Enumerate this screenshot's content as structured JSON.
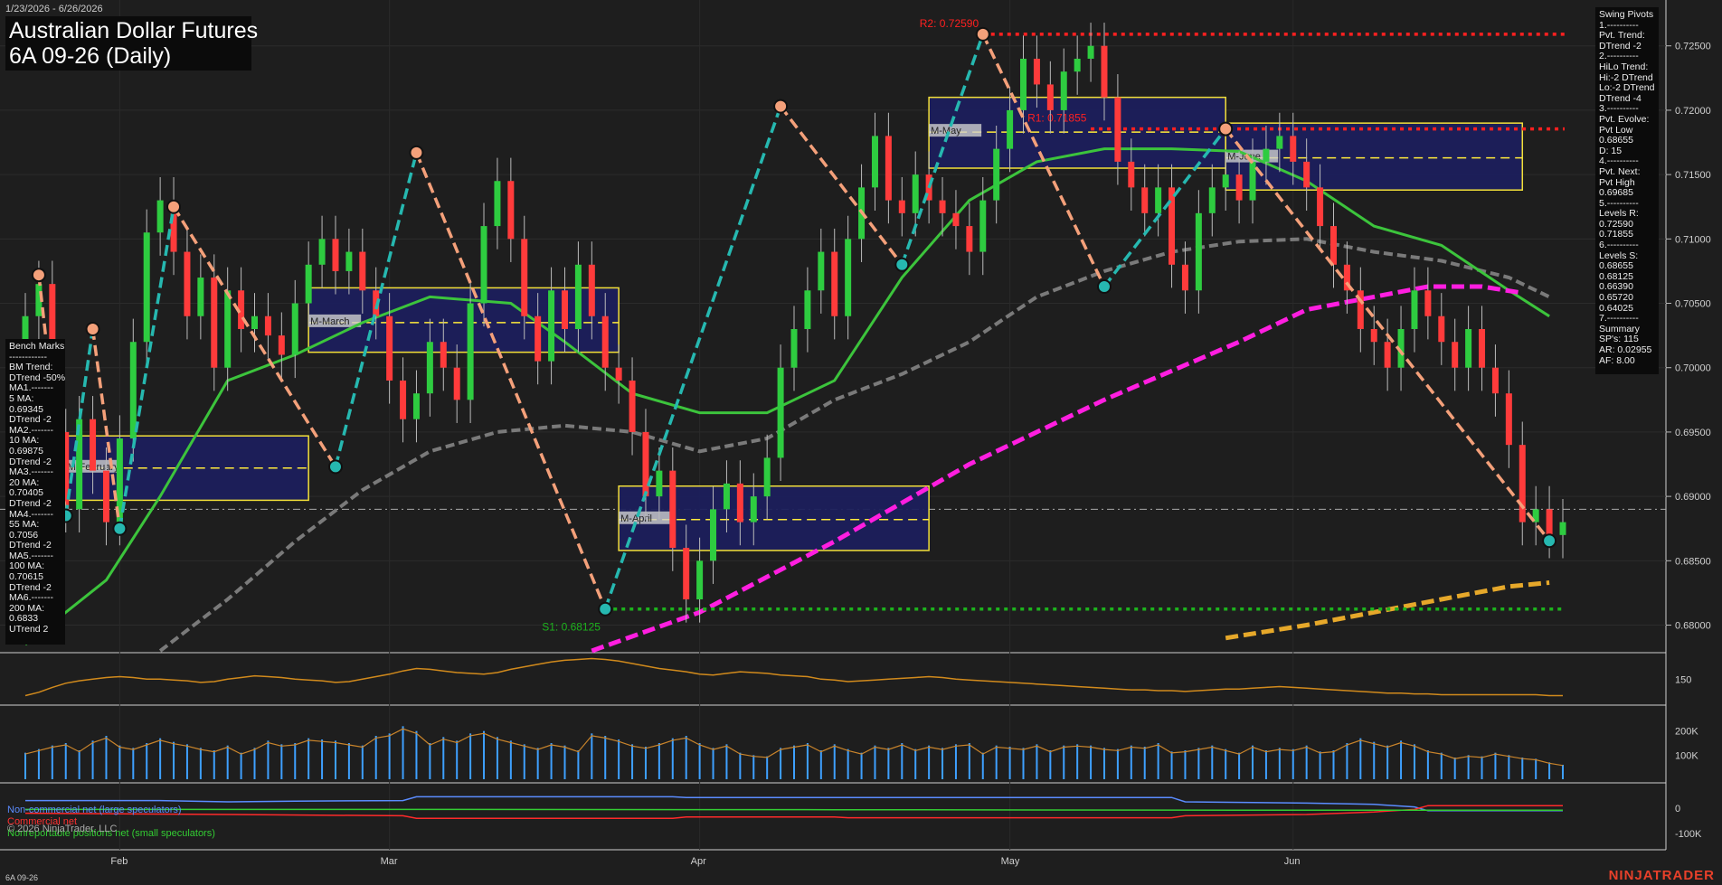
{
  "header": {
    "date_range": "1/23/2026 - 6/26/2026",
    "title_line1": "Australian Dollar Futures",
    "title_line2": "6A 09-26 (Daily)"
  },
  "footer": {
    "symbol": "6A 09-26",
    "brand": "NINJATRADER",
    "copyright": "© 2026 NinjaTrader, LLC"
  },
  "bench_marks": [
    "Bench Marks",
    "------------",
    "BM Trend:",
    "DTrend -50%",
    "MA1.-------",
    "5 MA:",
    "0.69345",
    "DTrend -2",
    "MA2.-------",
    "10 MA:",
    "0.69875",
    "DTrend -2",
    "MA3.-------",
    "20 MA:",
    "0.70405",
    "DTrend -2",
    "MA4.-------",
    "55 MA:",
    "0.7056",
    "DTrend -2",
    "MA5.-------",
    "100 MA:",
    "0.70615",
    "DTrend -2",
    "MA6.-------",
    "200 MA:",
    "0.6833",
    "UTrend 2"
  ],
  "swing_pivots": [
    "Swing Pivots",
    "1.----------",
    "Pvt. Trend:",
    "DTrend -2",
    "2.----------",
    "HiLo Trend:",
    "Hi:-2 DTrend",
    "Lo:-2 DTrend",
    "DTrend -4",
    "3.----------",
    "Pvt. Evolve:",
    "Pvt Low",
    "0.68655",
    "D: 15",
    "4.----------",
    "Pvt. Next:",
    "Pvt High",
    "0.69685",
    "5.----------",
    "Levels R:",
    "0.72590",
    "0.71855",
    "6.----------",
    "Levels S:",
    "0.68655",
    "0.68125",
    "0.66390",
    "0.65720",
    "0.64025",
    "7.----------",
    "Summary",
    "SP's: 115",
    "AR: 0.02955",
    "AF: 8.00"
  ],
  "cot_legend": {
    "noncommercial": "Non-commercial net (large speculators)",
    "commercial": "Commercial net",
    "nonreportable": "Nonreportable positions net (small speculators)"
  },
  "colors": {
    "background": "#1e1e1e",
    "up_candle": "#2ecc40",
    "down_candle": "#ff3b3b",
    "swing_up": "#26b8b0",
    "swing_down": "#f4a07a",
    "ma_green": "#3cc43c",
    "ma_grey": "#7a7a7a",
    "ma_magenta": "#ff1ee0",
    "ma_orange": "#e6a82a",
    "resistance": "#ff2020",
    "support": "#1db31d",
    "box_fill": "#1c1f5c",
    "box_border": "#ffeb3b",
    "volume": "#3ea0ff"
  },
  "chart_data": {
    "type": "candlestick",
    "price_axis": {
      "ylim": [
        0.678,
        0.728
      ],
      "ticks": [
        0.68,
        0.685,
        0.69,
        0.695,
        0.7,
        0.705,
        0.71,
        0.715,
        0.72,
        0.725
      ]
    },
    "month_labels": [
      {
        "label": "Feb",
        "day": 7
      },
      {
        "label": "Mar",
        "day": 27
      },
      {
        "label": "Apr",
        "day": 50
      },
      {
        "label": "May",
        "day": 73
      },
      {
        "label": "Jun",
        "day": 94
      }
    ],
    "day_count": 115,
    "closes": [
      0.704,
      0.7065,
      0.695,
      0.689,
      0.696,
      0.692,
      0.688,
      0.6945,
      0.702,
      0.7105,
      0.713,
      0.709,
      0.704,
      0.707,
      0.7,
      0.706,
      0.703,
      0.704,
      0.7025,
      0.701,
      0.705,
      0.708,
      0.71,
      0.7075,
      0.709,
      0.706,
      0.704,
      0.699,
      0.696,
      0.698,
      0.702,
      0.7,
      0.6975,
      0.705,
      0.711,
      0.7145,
      0.71,
      0.704,
      0.7005,
      0.706,
      0.703,
      0.708,
      0.704,
      0.7,
      0.699,
      0.695,
      0.69,
      0.692,
      0.686,
      0.682,
      0.685,
      0.689,
      0.691,
      0.688,
      0.69,
      0.693,
      0.7,
      0.703,
      0.706,
      0.709,
      0.704,
      0.71,
      0.714,
      0.718,
      0.713,
      0.712,
      0.715,
      0.713,
      0.712,
      0.711,
      0.709,
      0.713,
      0.717,
      0.72,
      0.724,
      0.722,
      0.72,
      0.723,
      0.724,
      0.725,
      0.721,
      0.716,
      0.714,
      0.712,
      0.714,
      0.708,
      0.706,
      0.712,
      0.714,
      0.715,
      0.713,
      0.716,
      0.717,
      0.718,
      0.716,
      0.714,
      0.711,
      0.708,
      0.706,
      0.703,
      0.702,
      0.7,
      0.703,
      0.706,
      0.704,
      0.702,
      0.7,
      0.703,
      0.7,
      0.698,
      0.694,
      0.688,
      0.689,
      0.687,
      0.688
    ],
    "swing_pivots": [
      {
        "day": 1,
        "price": 0.7072,
        "kind": "high"
      },
      {
        "day": 3,
        "price": 0.6885,
        "kind": "low"
      },
      {
        "day": 5,
        "price": 0.703,
        "kind": "high"
      },
      {
        "day": 7,
        "price": 0.6875,
        "kind": "low"
      },
      {
        "day": 11,
        "price": 0.7125,
        "kind": "high"
      },
      {
        "day": 23,
        "price": 0.6923,
        "kind": "low"
      },
      {
        "day": 29,
        "price": 0.7167,
        "kind": "high"
      },
      {
        "day": 43,
        "price": 0.68125,
        "kind": "low"
      },
      {
        "day": 56,
        "price": 0.7203,
        "kind": "high"
      },
      {
        "day": 65,
        "price": 0.708,
        "kind": "low"
      },
      {
        "day": 71,
        "price": 0.7259,
        "kind": "high"
      },
      {
        "day": 80,
        "price": 0.7063,
        "kind": "low"
      },
      {
        "day": 89,
        "price": 0.71855,
        "kind": "high"
      },
      {
        "day": 113,
        "price": 0.68655,
        "kind": "low"
      }
    ],
    "levels": [
      {
        "label": "R2: 0.72590",
        "price": 0.7259,
        "kind": "resistance"
      },
      {
        "label": "R1: 0.71855",
        "price": 0.71855,
        "kind": "resistance"
      },
      {
        "label": "S1: 0.68125",
        "price": 0.68125,
        "kind": "support"
      }
    ],
    "monthly_boxes": [
      {
        "label": "M-February",
        "day_start": 3,
        "day_end": 21,
        "high": 0.6947,
        "low": 0.6897,
        "mid": 0.6922
      },
      {
        "label": "M-March",
        "day_start": 21,
        "day_end": 44,
        "high": 0.7062,
        "low": 0.7012,
        "mid": 0.7035
      },
      {
        "label": "M-April",
        "day_start": 44,
        "day_end": 67,
        "high": 0.6908,
        "low": 0.6858,
        "mid": 0.6882
      },
      {
        "label": "M-May",
        "day_start": 67,
        "day_end": 89,
        "high": 0.721,
        "low": 0.7155,
        "mid": 0.7183
      },
      {
        "label": "M-June",
        "day_start": 89,
        "day_end": 111,
        "high": 0.719,
        "low": 0.7138,
        "mid": 0.7163
      }
    ],
    "moving_averages": {
      "ma_green": [
        [
          0,
          0.6785
        ],
        [
          6,
          0.6835
        ],
        [
          10,
          0.69
        ],
        [
          15,
          0.699
        ],
        [
          20,
          0.701
        ],
        [
          25,
          0.7035
        ],
        [
          30,
          0.7055
        ],
        [
          36,
          0.705
        ],
        [
          40,
          0.702
        ],
        [
          45,
          0.698
        ],
        [
          50,
          0.6965
        ],
        [
          55,
          0.6965
        ],
        [
          60,
          0.699
        ],
        [
          65,
          0.707
        ],
        [
          70,
          0.713
        ],
        [
          75,
          0.716
        ],
        [
          80,
          0.717
        ],
        [
          85,
          0.717
        ],
        [
          90,
          0.7168
        ],
        [
          95,
          0.7145
        ],
        [
          100,
          0.711
        ],
        [
          105,
          0.7095
        ],
        [
          110,
          0.706
        ],
        [
          113,
          0.704
        ]
      ],
      "ma_grey": [
        [
          10,
          0.678
        ],
        [
          15,
          0.682
        ],
        [
          20,
          0.6865
        ],
        [
          25,
          0.6905
        ],
        [
          30,
          0.6935
        ],
        [
          35,
          0.695
        ],
        [
          40,
          0.6955
        ],
        [
          45,
          0.695
        ],
        [
          50,
          0.6935
        ],
        [
          55,
          0.6945
        ],
        [
          60,
          0.6975
        ],
        [
          65,
          0.6995
        ],
        [
          70,
          0.702
        ],
        [
          75,
          0.7055
        ],
        [
          80,
          0.7075
        ],
        [
          85,
          0.709
        ],
        [
          90,
          0.7098
        ],
        [
          95,
          0.71
        ],
        [
          100,
          0.709
        ],
        [
          105,
          0.7083
        ],
        [
          110,
          0.707
        ],
        [
          113,
          0.7055
        ]
      ],
      "ma_magenta": [
        [
          42,
          0.678
        ],
        [
          50,
          0.681
        ],
        [
          60,
          0.6865
        ],
        [
          70,
          0.6925
        ],
        [
          80,
          0.6975
        ],
        [
          90,
          0.702
        ],
        [
          95,
          0.7045
        ],
        [
          100,
          0.7055
        ],
        [
          104,
          0.7063
        ],
        [
          108,
          0.7063
        ],
        [
          111,
          0.7058
        ]
      ],
      "ma_orange": [
        [
          89,
          0.679
        ],
        [
          95,
          0.68
        ],
        [
          100,
          0.681
        ],
        [
          105,
          0.682
        ],
        [
          110,
          0.683
        ],
        [
          113,
          0.6833
        ]
      ]
    },
    "indicator_panel": {
      "tick": "150",
      "values": [
        130,
        134,
        140,
        145,
        148,
        150,
        152,
        153,
        152,
        150,
        150,
        149,
        148,
        146,
        147,
        150,
        152,
        154,
        153,
        152,
        150,
        149,
        148,
        146,
        147,
        150,
        153,
        156,
        160,
        163,
        162,
        160,
        158,
        157,
        156,
        158,
        162,
        165,
        168,
        171,
        173,
        174,
        175,
        174,
        172,
        169,
        166,
        163,
        161,
        159,
        156,
        155,
        157,
        159,
        158,
        157,
        155,
        154,
        153,
        150,
        149,
        147,
        148,
        149,
        150,
        151,
        152,
        153,
        152,
        150,
        149,
        148,
        147,
        146,
        145,
        144,
        143,
        142,
        141,
        140,
        139,
        138,
        137,
        137,
        136,
        136,
        135,
        136,
        137,
        138,
        138,
        139,
        140,
        141,
        140,
        139,
        138,
        137,
        136,
        135,
        134,
        133,
        133,
        132,
        132,
        131,
        131,
        131,
        131,
        131,
        131,
        131,
        131,
        130,
        130
      ]
    },
    "volume_panel": {
      "ticks": [
        "200K",
        "100K"
      ],
      "max": 300000,
      "values": [
        110000,
        125000,
        140000,
        150000,
        120000,
        160000,
        180000,
        140000,
        130000,
        150000,
        170000,
        155000,
        145000,
        130000,
        120000,
        140000,
        110000,
        130000,
        160000,
        145000,
        150000,
        170000,
        165000,
        160000,
        150000,
        140000,
        180000,
        190000,
        220000,
        200000,
        150000,
        175000,
        160000,
        190000,
        200000,
        175000,
        160000,
        145000,
        130000,
        150000,
        140000,
        120000,
        190000,
        180000,
        165000,
        145000,
        135000,
        150000,
        170000,
        180000,
        150000,
        130000,
        145000,
        110000,
        100000,
        95000,
        130000,
        140000,
        150000,
        120000,
        145000,
        125000,
        110000,
        140000,
        130000,
        150000,
        125000,
        140000,
        130000,
        145000,
        150000,
        110000,
        140000,
        135000,
        130000,
        145000,
        120000,
        140000,
        145000,
        140000,
        130000,
        125000,
        140000,
        135000,
        150000,
        115000,
        120000,
        130000,
        140000,
        125000,
        110000,
        140000,
        120000,
        130000,
        125000,
        140000,
        115000,
        120000,
        150000,
        170000,
        155000,
        140000,
        160000,
        145000,
        120000,
        110000,
        90000,
        100000,
        95000,
        110000,
        100000,
        90000,
        85000,
        70000,
        60000
      ]
    },
    "cot_panel": {
      "ticks": [
        "0",
        "-100K"
      ],
      "noncommercial": [
        [
          0,
          30000
        ],
        [
          10,
          30000
        ],
        [
          15,
          25000
        ],
        [
          20,
          28000
        ],
        [
          28,
          30000
        ],
        [
          29,
          45000
        ],
        [
          48,
          45000
        ],
        [
          49,
          42000
        ],
        [
          85,
          42000
        ],
        [
          86,
          25000
        ],
        [
          95,
          20000
        ],
        [
          100,
          15000
        ],
        [
          103,
          5000
        ],
        [
          104,
          -10000
        ],
        [
          115,
          -10000
        ]
      ],
      "commercial": [
        [
          0,
          -20000
        ],
        [
          15,
          -25000
        ],
        [
          28,
          -30000
        ],
        [
          29,
          -40000
        ],
        [
          48,
          -40000
        ],
        [
          49,
          -35000
        ],
        [
          60,
          -35000
        ],
        [
          61,
          -38000
        ],
        [
          85,
          -38000
        ],
        [
          86,
          -30000
        ],
        [
          95,
          -25000
        ],
        [
          100,
          -15000
        ],
        [
          103,
          -5000
        ],
        [
          104,
          10000
        ],
        [
          115,
          10000
        ]
      ],
      "nonreportable": [
        [
          0,
          -5000
        ],
        [
          30,
          -5000
        ],
        [
          60,
          -6000
        ],
        [
          90,
          -8000
        ],
        [
          115,
          -8000
        ]
      ]
    }
  }
}
